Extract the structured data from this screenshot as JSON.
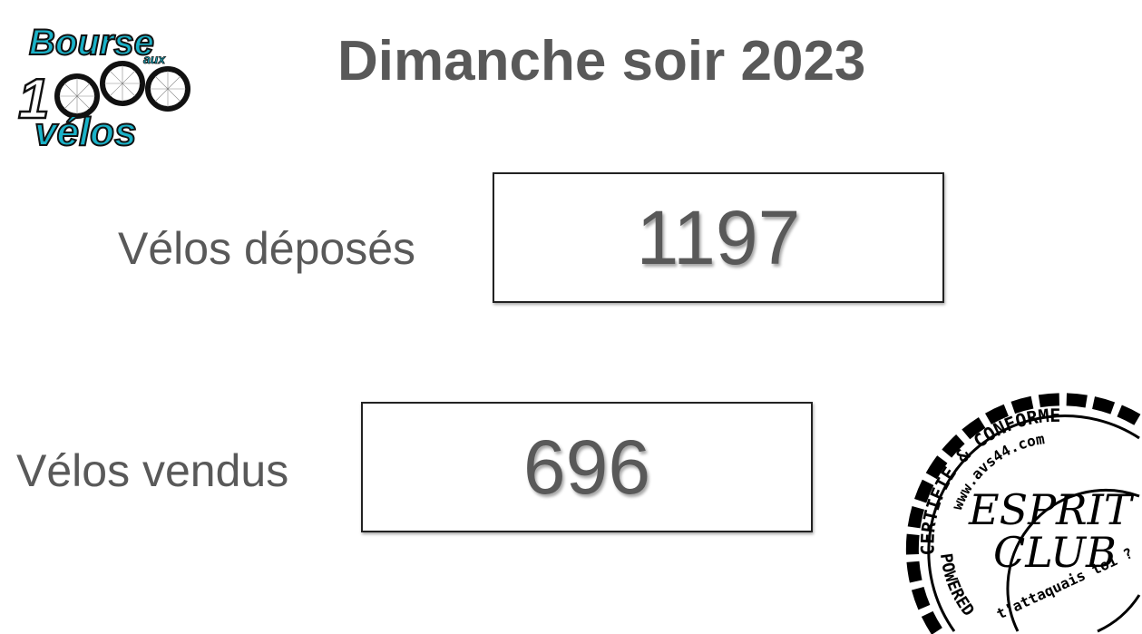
{
  "title": "Dimanche soir 2023",
  "logo": {
    "line1": "Bourse",
    "line2": "aux",
    "line3": "1000",
    "line4": "vélos",
    "accent": "#1ab2c8"
  },
  "stats": [
    {
      "label": "Vélos déposés",
      "value": "1197"
    },
    {
      "label": "Vélos vendus",
      "value": "696"
    }
  ],
  "stamp": {
    "top_arc": "CERTIFIÉ & CONFORME",
    "url": "www.avs44.com",
    "line1": "ESPRIT",
    "line2": "CLUB",
    "bottom_inner": "t'attaquais toi ?",
    "bottom_outer": "POWERED BY AVS"
  }
}
